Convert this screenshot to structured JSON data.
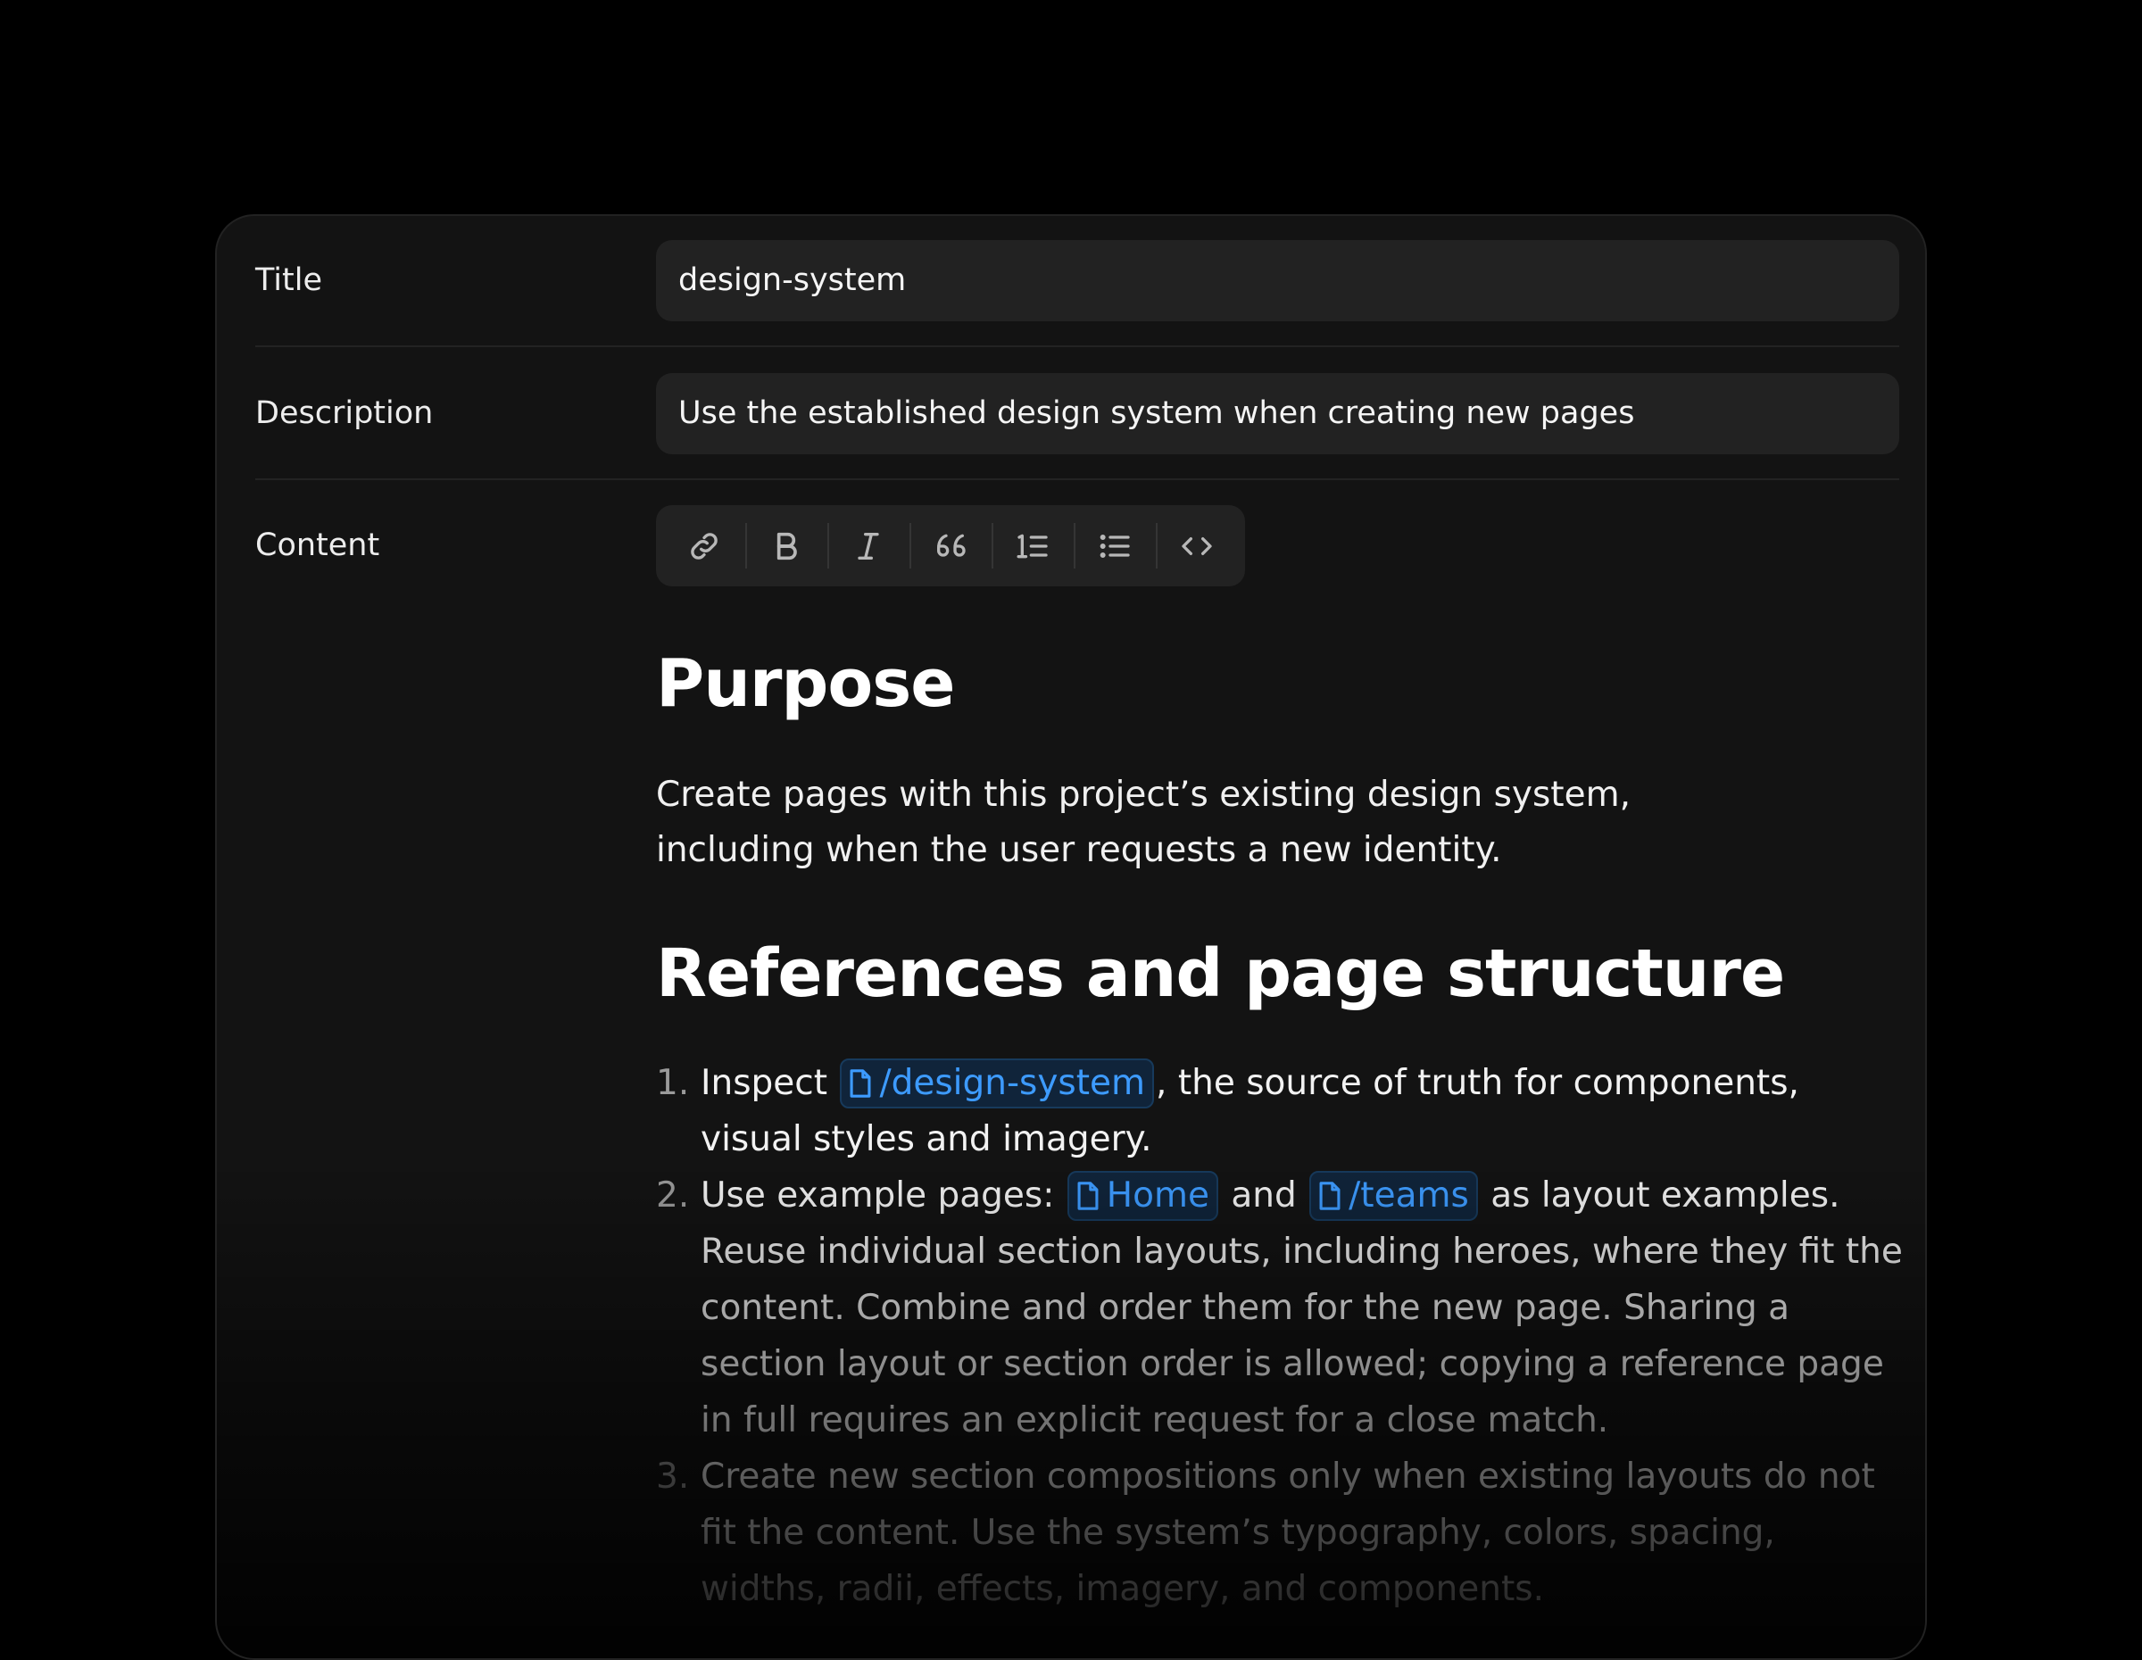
{
  "form": {
    "title_label": "Title",
    "title_value": "design-system",
    "description_label": "Description",
    "description_value": "Use the established design system when creating new pages",
    "content_label": "Content"
  },
  "toolbar": {
    "buttons": [
      {
        "icon": "link-icon"
      },
      {
        "icon": "bold-icon"
      },
      {
        "icon": "italic-icon"
      },
      {
        "icon": "quote-icon"
      },
      {
        "icon": "ordered-list-icon"
      },
      {
        "icon": "bullet-list-icon"
      },
      {
        "icon": "code-icon"
      }
    ]
  },
  "content": {
    "heading_purpose": "Purpose",
    "purpose_text": "Create pages with this project’s existing design system, including when the user requests a new identity.",
    "heading_refs": "References and page structure",
    "items": [
      {
        "num": "1.",
        "before": "Inspect",
        "chip": "/design-system",
        "after": ", the source of truth for components, visual styles and imagery."
      },
      {
        "num": "2.",
        "before": "Use example pages:",
        "chip1": "Home",
        "mid": "and",
        "chip2": "/teams",
        "after": "as layout examples. Reuse individual section layouts, including heroes, where they fit the content. Combine and order them for the new page. Sharing a section layout or section order is allowed; copying a reference page in full requires an explicit request for a close match."
      },
      {
        "num": "3.",
        "text": "Create new section compositions only when existing layouts do not fit the content. Use the system’s typography, colors, spacing, widths, radii, effects, imagery, and components."
      }
    ]
  },
  "colors": {
    "background": "#000000",
    "card": "#131313",
    "field": "#222222",
    "chip_text": "#3d9bff",
    "chip_bg": "#10243a"
  }
}
